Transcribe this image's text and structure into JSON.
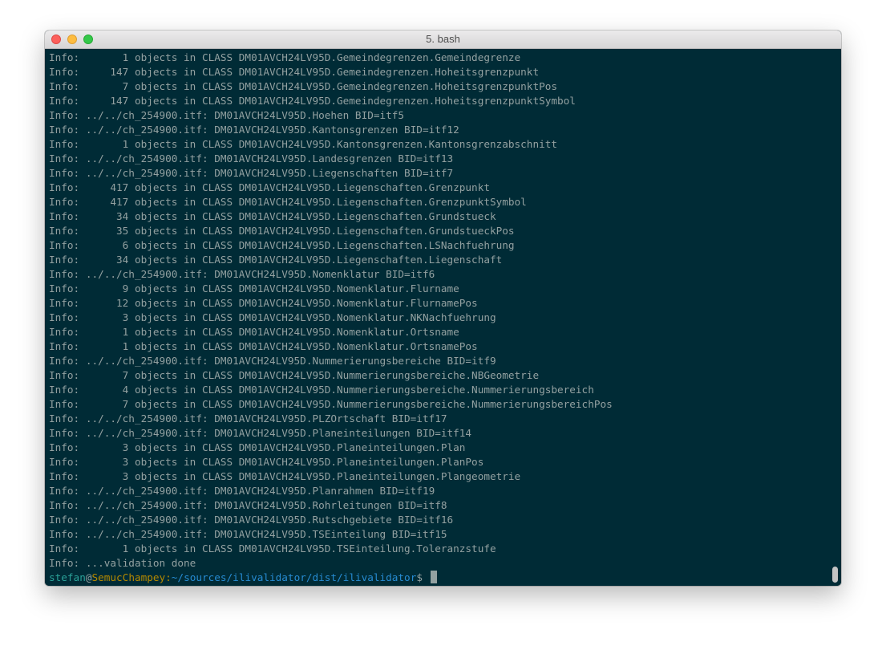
{
  "window": {
    "title": "5. bash"
  },
  "output_lines": [
    "Info:       1 objects in CLASS DM01AVCH24LV95D.Gemeindegrenzen.Gemeindegrenze",
    "Info:     147 objects in CLASS DM01AVCH24LV95D.Gemeindegrenzen.Hoheitsgrenzpunkt",
    "Info:       7 objects in CLASS DM01AVCH24LV95D.Gemeindegrenzen.HoheitsgrenzpunktPos",
    "Info:     147 objects in CLASS DM01AVCH24LV95D.Gemeindegrenzen.HoheitsgrenzpunktSymbol",
    "Info: ../../ch_254900.itf: DM01AVCH24LV95D.Hoehen BID=itf5",
    "Info: ../../ch_254900.itf: DM01AVCH24LV95D.Kantonsgrenzen BID=itf12",
    "Info:       1 objects in CLASS DM01AVCH24LV95D.Kantonsgrenzen.Kantonsgrenzabschnitt",
    "Info: ../../ch_254900.itf: DM01AVCH24LV95D.Landesgrenzen BID=itf13",
    "Info: ../../ch_254900.itf: DM01AVCH24LV95D.Liegenschaften BID=itf7",
    "Info:     417 objects in CLASS DM01AVCH24LV95D.Liegenschaften.Grenzpunkt",
    "Info:     417 objects in CLASS DM01AVCH24LV95D.Liegenschaften.GrenzpunktSymbol",
    "Info:      34 objects in CLASS DM01AVCH24LV95D.Liegenschaften.Grundstueck",
    "Info:      35 objects in CLASS DM01AVCH24LV95D.Liegenschaften.GrundstueckPos",
    "Info:       6 objects in CLASS DM01AVCH24LV95D.Liegenschaften.LSNachfuehrung",
    "Info:      34 objects in CLASS DM01AVCH24LV95D.Liegenschaften.Liegenschaft",
    "Info: ../../ch_254900.itf: DM01AVCH24LV95D.Nomenklatur BID=itf6",
    "Info:       9 objects in CLASS DM01AVCH24LV95D.Nomenklatur.Flurname",
    "Info:      12 objects in CLASS DM01AVCH24LV95D.Nomenklatur.FlurnamePos",
    "Info:       3 objects in CLASS DM01AVCH24LV95D.Nomenklatur.NKNachfuehrung",
    "Info:       1 objects in CLASS DM01AVCH24LV95D.Nomenklatur.Ortsname",
    "Info:       1 objects in CLASS DM01AVCH24LV95D.Nomenklatur.OrtsnamePos",
    "Info: ../../ch_254900.itf: DM01AVCH24LV95D.Nummerierungsbereiche BID=itf9",
    "Info:       7 objects in CLASS DM01AVCH24LV95D.Nummerierungsbereiche.NBGeometrie",
    "Info:       4 objects in CLASS DM01AVCH24LV95D.Nummerierungsbereiche.Nummerierungsbereich",
    "Info:       7 objects in CLASS DM01AVCH24LV95D.Nummerierungsbereiche.NummerierungsbereichPos",
    "Info: ../../ch_254900.itf: DM01AVCH24LV95D.PLZOrtschaft BID=itf17",
    "Info: ../../ch_254900.itf: DM01AVCH24LV95D.Planeinteilungen BID=itf14",
    "Info:       3 objects in CLASS DM01AVCH24LV95D.Planeinteilungen.Plan",
    "Info:       3 objects in CLASS DM01AVCH24LV95D.Planeinteilungen.PlanPos",
    "Info:       3 objects in CLASS DM01AVCH24LV95D.Planeinteilungen.Plangeometrie",
    "Info: ../../ch_254900.itf: DM01AVCH24LV95D.Planrahmen BID=itf19",
    "Info: ../../ch_254900.itf: DM01AVCH24LV95D.Rohrleitungen BID=itf8",
    "Info: ../../ch_254900.itf: DM01AVCH24LV95D.Rutschgebiete BID=itf16",
    "Info: ../../ch_254900.itf: DM01AVCH24LV95D.TSEinteilung BID=itf15",
    "Info:       1 objects in CLASS DM01AVCH24LV95D.TSEinteilung.Toleranzstufe",
    "Info: ...validation done"
  ],
  "prompt": {
    "user": "stefan",
    "at": "@",
    "host": "SemucChampey",
    "colon": ":",
    "path": "~/sources/ilivalidator/dist/ilivalidator",
    "symbol": "$ "
  },
  "colors": {
    "background": "#002b36",
    "foreground": "#93a1a1",
    "prompt_user": "#2aa198",
    "prompt_host": "#b58900",
    "prompt_path": "#268bd2"
  }
}
